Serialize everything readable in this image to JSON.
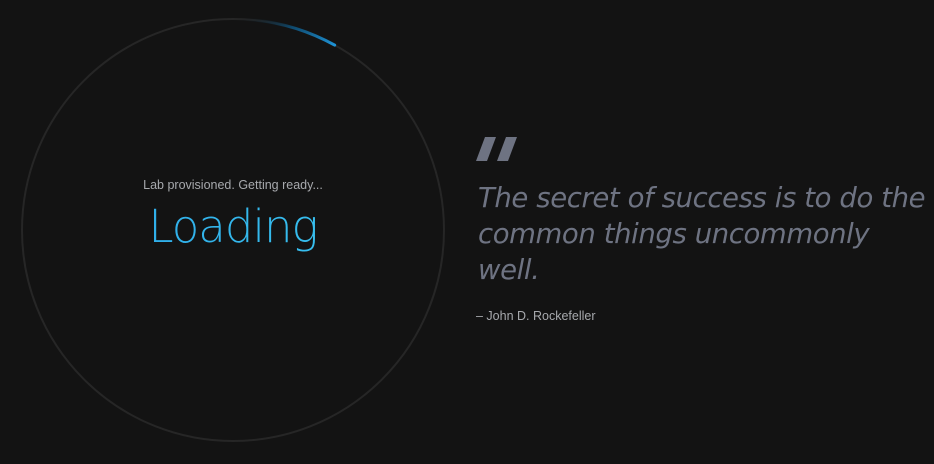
{
  "loader": {
    "status": "Lab provisioned. Getting ready...",
    "title": "Loading",
    "progress": 0.08,
    "accent_color": "#1e88c7",
    "track_color": "#262626"
  },
  "quote": {
    "icon": "quote-icon",
    "text": "The secret of success is to do the common things uncommonly well.",
    "attribution": "– John D. Rockefeller"
  }
}
